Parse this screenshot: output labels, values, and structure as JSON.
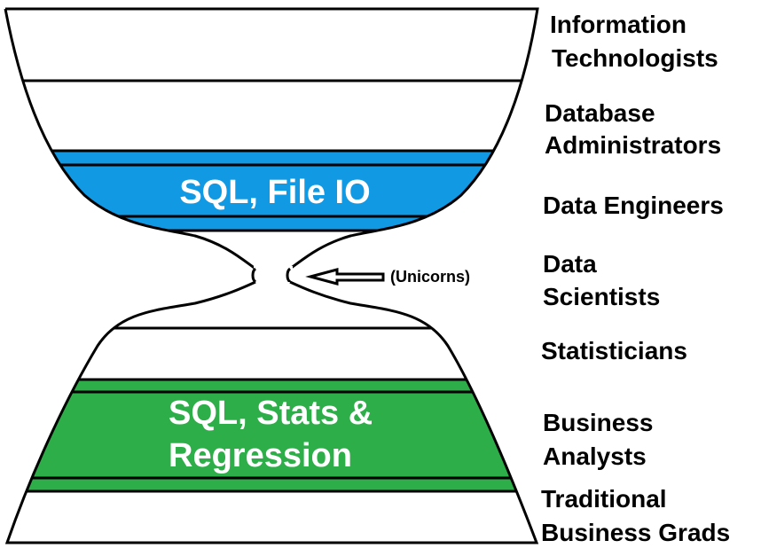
{
  "colors": {
    "background": "#ffffff",
    "outline": "#000000",
    "top_band": "#1199e3",
    "bottom_band": "#2eae49",
    "band_text": "#ffffff"
  },
  "bands": {
    "top": {
      "label": "SQL, File IO"
    },
    "bottom": {
      "line1": "SQL, Stats &",
      "line2": "Regression"
    }
  },
  "annotation": {
    "label": "(Unicorns)",
    "icon": "outline-arrow-left-icon"
  },
  "roles": [
    {
      "id": "information-technologists",
      "lines": [
        "Information",
        "Technologists"
      ]
    },
    {
      "id": "database-administrators",
      "lines": [
        "Database",
        "Administrators"
      ]
    },
    {
      "id": "data-engineers",
      "lines": [
        "Data Engineers"
      ]
    },
    {
      "id": "data-scientists",
      "lines": [
        "Data",
        "Scientists"
      ]
    },
    {
      "id": "statisticians",
      "lines": [
        "Statisticians"
      ]
    },
    {
      "id": "business-analysts",
      "lines": [
        "Business",
        "Analysts"
      ]
    },
    {
      "id": "traditional-business-grads",
      "lines": [
        "Traditional",
        "Business Grads"
      ]
    }
  ]
}
